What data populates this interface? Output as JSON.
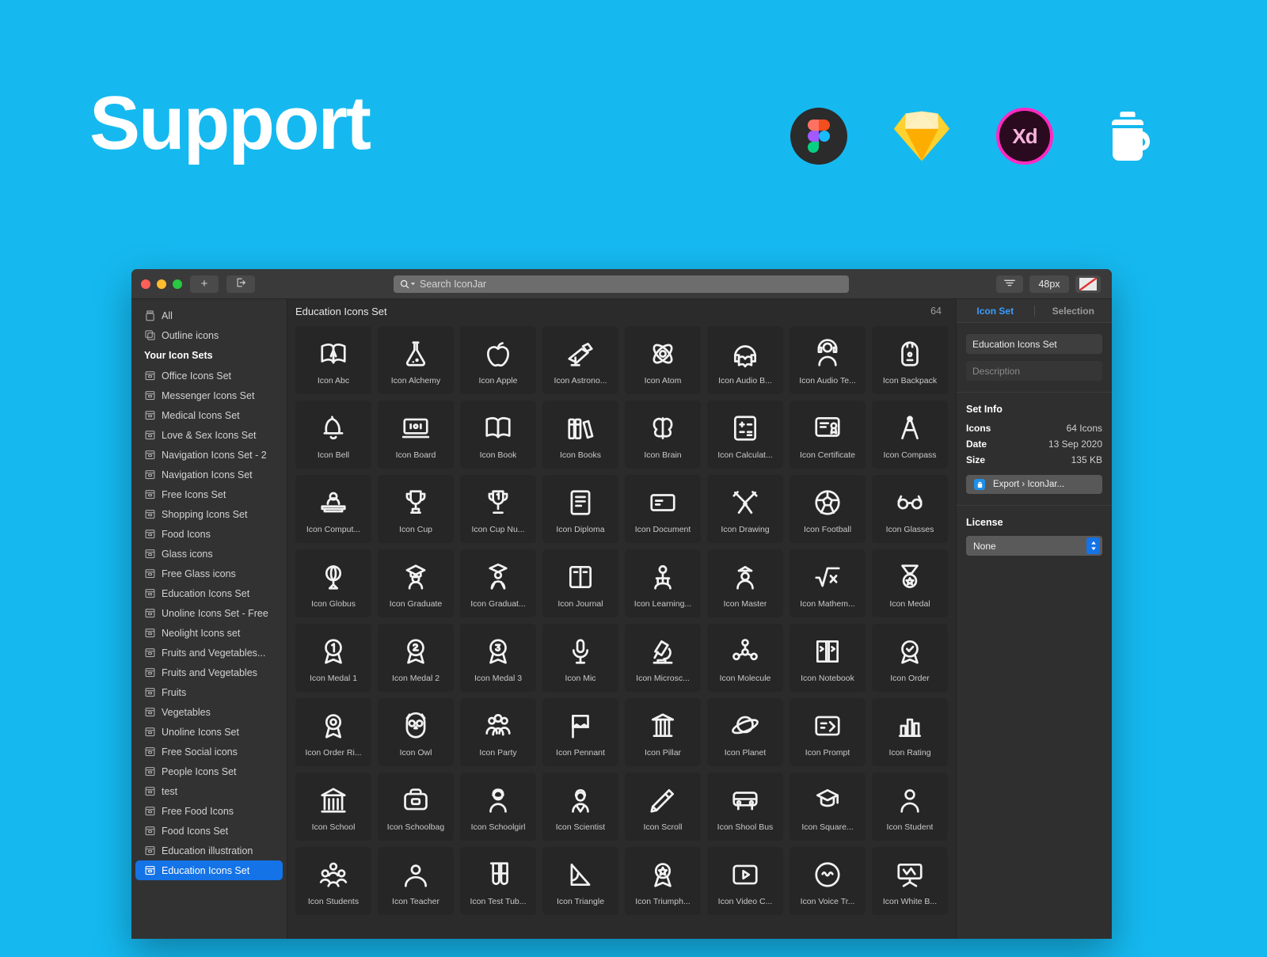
{
  "promo": {
    "title": "Support",
    "logos": [
      {
        "name": "figma-logo",
        "label": "Figma"
      },
      {
        "name": "sketch-logo",
        "label": "Sketch"
      },
      {
        "name": "adobe-xd-logo",
        "label": "Xd"
      },
      {
        "name": "iconjar-logo",
        "label": "IconJar"
      }
    ],
    "background_color": "#15b9f0"
  },
  "toolbar": {
    "add_label": "+",
    "export_label": "Export",
    "search_placeholder": "Search IconJar",
    "size_label": "48px",
    "filter_label": "Filter"
  },
  "sidebar": {
    "top_items": [
      {
        "label": "All",
        "icon": "jar-icon"
      },
      {
        "label": "Outline icons",
        "icon": "stack-icon"
      }
    ],
    "section_header": "Your Icon Sets",
    "items": [
      {
        "label": "Office Icons Set"
      },
      {
        "label": "Messenger Icons Set"
      },
      {
        "label": "Medical Icons Set"
      },
      {
        "label": "Love & Sex Icons Set"
      },
      {
        "label": "Navigation Icons Set - 2"
      },
      {
        "label": "Navigation Icons Set"
      },
      {
        "label": "Free Icons Set"
      },
      {
        "label": "Shopping Icons Set"
      },
      {
        "label": "Food Icons"
      },
      {
        "label": "Glass icons"
      },
      {
        "label": "Free Glass icons"
      },
      {
        "label": "Education Icons Set"
      },
      {
        "label": "Unoline Icons Set - Free"
      },
      {
        "label": "Neolight Icons set"
      },
      {
        "label": "Fruits and Vegetables..."
      },
      {
        "label": "Fruits and Vegetables"
      },
      {
        "label": "Fruits"
      },
      {
        "label": "Vegetables"
      },
      {
        "label": "Unoline Icons Set"
      },
      {
        "label": "Free Social icons"
      },
      {
        "label": "People Icons Set"
      },
      {
        "label": "test"
      },
      {
        "label": "Free Food Icons"
      },
      {
        "label": "Food Icons Set"
      },
      {
        "label": "Education illustration"
      },
      {
        "label": "Education Icons Set",
        "selected": true
      }
    ]
  },
  "grid": {
    "title": "Education Icons Set",
    "count": "64",
    "icons": [
      {
        "label": "Icon Abc",
        "glyph": "book-a"
      },
      {
        "label": "Icon Alchemy",
        "glyph": "flask"
      },
      {
        "label": "Icon Apple",
        "glyph": "apple"
      },
      {
        "label": "Icon Astrono...",
        "glyph": "telescope"
      },
      {
        "label": "Icon Atom",
        "glyph": "atom"
      },
      {
        "label": "Icon Audio B...",
        "glyph": "audiobook"
      },
      {
        "label": "Icon Audio Te...",
        "glyph": "audio-teacher"
      },
      {
        "label": "Icon Backpack",
        "glyph": "backpack"
      },
      {
        "label": "Icon Bell",
        "glyph": "bell"
      },
      {
        "label": "Icon Board",
        "glyph": "board"
      },
      {
        "label": "Icon Book",
        "glyph": "book"
      },
      {
        "label": "Icon Books",
        "glyph": "books"
      },
      {
        "label": "Icon Brain",
        "glyph": "brain"
      },
      {
        "label": "Icon Calculat...",
        "glyph": "calculator"
      },
      {
        "label": "Icon Certificate",
        "glyph": "certificate"
      },
      {
        "label": "Icon Compass",
        "glyph": "compass"
      },
      {
        "label": "Icon Comput...",
        "glyph": "computer"
      },
      {
        "label": "Icon Cup",
        "glyph": "cup"
      },
      {
        "label": "Icon Cup Nu...",
        "glyph": "cup-number"
      },
      {
        "label": "Icon Diploma",
        "glyph": "diploma"
      },
      {
        "label": "Icon Document",
        "glyph": "document"
      },
      {
        "label": "Icon Drawing",
        "glyph": "drawing"
      },
      {
        "label": "Icon Football",
        "glyph": "football"
      },
      {
        "label": "Icon Glasses",
        "glyph": "glasses"
      },
      {
        "label": "Icon Globus",
        "glyph": "globus"
      },
      {
        "label": "Icon Graduate",
        "glyph": "graduate"
      },
      {
        "label": "Icon Graduat...",
        "glyph": "graduate2"
      },
      {
        "label": "Icon Journal",
        "glyph": "journal"
      },
      {
        "label": "Icon Learning...",
        "glyph": "learning"
      },
      {
        "label": "Icon Master",
        "glyph": "master"
      },
      {
        "label": "Icon Mathem...",
        "glyph": "math"
      },
      {
        "label": "Icon Medal",
        "glyph": "medal"
      },
      {
        "label": "Icon Medal 1",
        "glyph": "medal1"
      },
      {
        "label": "Icon Medal 2",
        "glyph": "medal2"
      },
      {
        "label": "Icon Medal 3",
        "glyph": "medal3"
      },
      {
        "label": "Icon Mic",
        "glyph": "mic"
      },
      {
        "label": "Icon Microsc...",
        "glyph": "microscope"
      },
      {
        "label": "Icon Molecule",
        "glyph": "molecule"
      },
      {
        "label": "Icon Notebook",
        "glyph": "notebook"
      },
      {
        "label": "Icon Order",
        "glyph": "order"
      },
      {
        "label": "Icon Order Ri...",
        "glyph": "order-ribbon"
      },
      {
        "label": "Icon Owl",
        "glyph": "owl"
      },
      {
        "label": "Icon Party",
        "glyph": "party"
      },
      {
        "label": "Icon Pennant",
        "glyph": "pennant"
      },
      {
        "label": "Icon Pillar",
        "glyph": "pillar"
      },
      {
        "label": "Icon Planet",
        "glyph": "planet"
      },
      {
        "label": "Icon Prompt",
        "glyph": "prompt"
      },
      {
        "label": "Icon Rating",
        "glyph": "rating"
      },
      {
        "label": "Icon School",
        "glyph": "school"
      },
      {
        "label": "Icon Schoolbag",
        "glyph": "schoolbag"
      },
      {
        "label": "Icon Schoolgirl",
        "glyph": "schoolgirl"
      },
      {
        "label": "Icon Scientist",
        "glyph": "scientist"
      },
      {
        "label": "Icon Scroll",
        "glyph": "scroll"
      },
      {
        "label": "Icon Shool Bus",
        "glyph": "bus"
      },
      {
        "label": "Icon Square...",
        "glyph": "square-cap"
      },
      {
        "label": "Icon Student",
        "glyph": "student"
      },
      {
        "label": "Icon Students",
        "glyph": "students"
      },
      {
        "label": "Icon Teacher",
        "glyph": "teacher"
      },
      {
        "label": "Icon Test Tub...",
        "glyph": "test-tubes"
      },
      {
        "label": "Icon Triangle",
        "glyph": "triangle"
      },
      {
        "label": "Icon Triumph...",
        "glyph": "triumph"
      },
      {
        "label": "Icon Video C...",
        "glyph": "video"
      },
      {
        "label": "Icon Voice Tr...",
        "glyph": "voice"
      },
      {
        "label": "Icon White B...",
        "glyph": "whiteboard"
      }
    ]
  },
  "inspector": {
    "tabs": [
      {
        "label": "Icon Set",
        "active": true
      },
      {
        "label": "Selection",
        "active": false
      }
    ],
    "set_name": "Education Icons Set",
    "description_placeholder": "Description",
    "set_info_title": "Set Info",
    "rows": [
      {
        "key": "Icons",
        "value": "64 Icons"
      },
      {
        "key": "Date",
        "value": "13 Sep 2020"
      },
      {
        "key": "Size",
        "value": "135 KB"
      }
    ],
    "export_label": "Export › IconJar...",
    "license_title": "License",
    "license_value": "None"
  }
}
